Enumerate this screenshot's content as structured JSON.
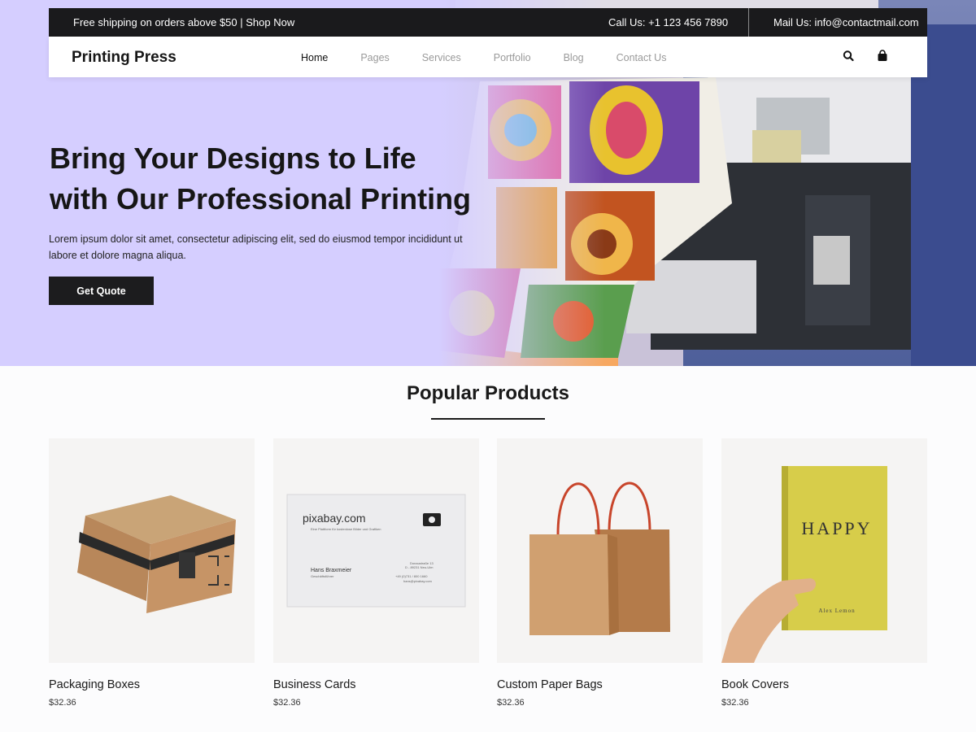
{
  "topbar": {
    "promo": "Free shipping on orders above $50 | Shop Now",
    "call": "Call Us: +1 123 456 7890",
    "mail": "Mail Us: info@contactmail.com"
  },
  "nav": {
    "brand": "Printing Press",
    "items": [
      "Home",
      "Pages",
      "Services",
      "Portfolio",
      "Blog",
      "Contact Us"
    ],
    "active": "Home"
  },
  "hero": {
    "title_line1": "Bring Your Designs to Life",
    "title_line2": "with Our Professional Printing",
    "subtitle": "Lorem ipsum dolor sit amet, consectetur adipiscing elit, sed do eiusmod tempor incididunt ut labore et dolore magna aliqua.",
    "cta": "Get Quote"
  },
  "products": {
    "title": "Popular Products",
    "items": [
      {
        "name": "Packaging Boxes",
        "price": "$32.36"
      },
      {
        "name": "Business Cards",
        "price": "$32.36"
      },
      {
        "name": "Custom Paper Bags",
        "price": "$32.36"
      },
      {
        "name": "Book Covers",
        "price": "$32.36"
      }
    ]
  },
  "card_image": {
    "brand": "pixabay.com",
    "tagline": "Eine Plattform für kostenlose Bilder und Grafiken",
    "person": "Hans Braxmeier",
    "role": "Geschäftsführer",
    "address": [
      "Donaustraße 13",
      "D - 89231 Neu-Ulm"
    ],
    "phone": "+49 (0)731 / 800 1660",
    "email": "hans@pixabay.com"
  },
  "book_image": {
    "title": "HAPPY",
    "author": "Alex Lemon"
  },
  "colors": {
    "hero_bg": "#d5ceff",
    "dark": "#1a1a1c"
  }
}
